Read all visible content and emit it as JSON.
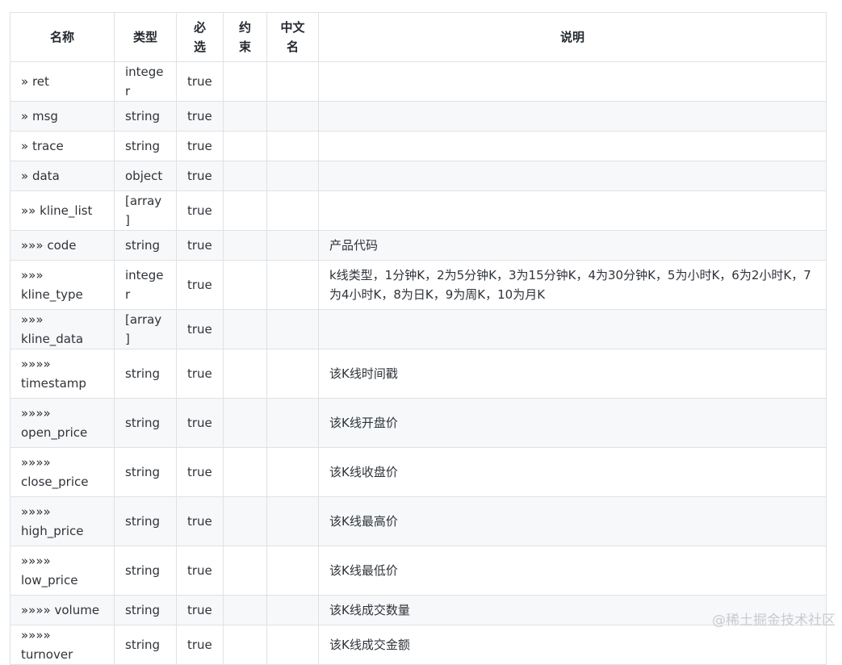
{
  "headers": [
    "名称",
    "类型",
    "必选",
    "约束",
    "中文名",
    "说明"
  ],
  "header_lines": {
    "name": "名称",
    "type": "类型",
    "required_1": "必",
    "required_2": "选",
    "constraint_1": "约",
    "constraint_2": "束",
    "cnname_1": "中文",
    "cnname_2": "名",
    "desc": "说明"
  },
  "rows": [
    {
      "prefix": "»",
      "name": "ret",
      "type": "integer",
      "required": "true",
      "constraint": "",
      "cn_name": "",
      "desc": ""
    },
    {
      "prefix": "»",
      "name": "msg",
      "type": "string",
      "required": "true",
      "constraint": "",
      "cn_name": "",
      "desc": ""
    },
    {
      "prefix": "»",
      "name": "trace",
      "type": "string",
      "required": "true",
      "constraint": "",
      "cn_name": "",
      "desc": ""
    },
    {
      "prefix": "»",
      "name": "data",
      "type": "object",
      "required": "true",
      "constraint": "",
      "cn_name": "",
      "desc": ""
    },
    {
      "prefix": "»»",
      "name": "kline_list",
      "type": "[array]",
      "required": "true",
      "constraint": "",
      "cn_name": "",
      "desc": ""
    },
    {
      "prefix": "»»»",
      "name": "code",
      "type": "string",
      "required": "true",
      "constraint": "",
      "cn_name": "",
      "desc": "产品代码"
    },
    {
      "prefix": "»»»",
      "name": "kline_type",
      "type": "integer",
      "required": "true",
      "constraint": "",
      "cn_name": "",
      "desc": "k线类型，1分钟K，2为5分钟K，3为15分钟K，4为30分钟K，5为小时K，6为2小时K，7为4小时K，8为日K，9为周K，10为月K"
    },
    {
      "prefix": "»»»",
      "name": "kline_data",
      "type": "[array]",
      "required": "true",
      "constraint": "",
      "cn_name": "",
      "desc": ""
    },
    {
      "prefix": "»»»»",
      "name": "timestamp",
      "type": "string",
      "required": "true",
      "constraint": "",
      "cn_name": "",
      "desc": "该K线时间戳"
    },
    {
      "prefix": "»»»»",
      "name": "open_price",
      "type": "string",
      "required": "true",
      "constraint": "",
      "cn_name": "",
      "desc": "该K线开盘价"
    },
    {
      "prefix": "»»»»",
      "name": "close_price",
      "type": "string",
      "required": "true",
      "constraint": "",
      "cn_name": "",
      "desc": "该K线收盘价"
    },
    {
      "prefix": "»»»»",
      "name": "high_price",
      "type": "string",
      "required": "true",
      "constraint": "",
      "cn_name": "",
      "desc": "该K线最高价"
    },
    {
      "prefix": "»»»»",
      "name": "low_price",
      "type": "string",
      "required": "true",
      "constraint": "",
      "cn_name": "",
      "desc": "该K线最低价"
    },
    {
      "prefix": "»»»»",
      "name": "volume",
      "type": "string",
      "required": "true",
      "constraint": "",
      "cn_name": "",
      "desc": "该K线成交数量"
    },
    {
      "prefix": "»»»»",
      "name": "turnover",
      "type": "string",
      "required": "true",
      "constraint": "",
      "cn_name": "",
      "desc": "该K线成交金额"
    }
  ],
  "watermark": "@稀土掘金技术社区"
}
